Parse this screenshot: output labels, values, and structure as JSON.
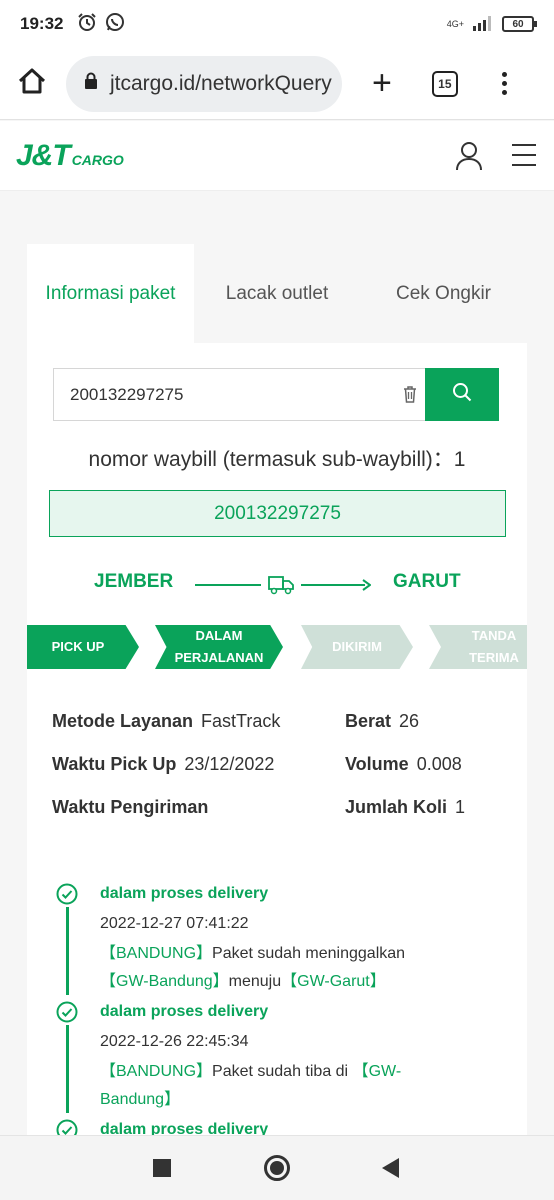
{
  "status_bar": {
    "time": "19:32",
    "network": "4G+",
    "battery": "60"
  },
  "browser": {
    "url": "jtcargo.id/networkQuery",
    "tab_count": "15"
  },
  "site": {
    "logo_main": "J&T",
    "logo_sub": "CARGO",
    "brand_color": "#0aa35a"
  },
  "tabs": [
    {
      "label": "Informasi paket",
      "active": true
    },
    {
      "label": "Lacak outlet",
      "active": false
    },
    {
      "label": "Cek Ongkir",
      "active": false
    }
  ],
  "search": {
    "value": "200132297275"
  },
  "waybill": {
    "count_label": "nomor waybill (termasuk sub-waybill)：1",
    "number": "200132297275"
  },
  "route": {
    "from": "JEMBER",
    "to": "GARUT"
  },
  "steps": [
    {
      "label": "PICK UP",
      "done": true
    },
    {
      "label": "DALAM PERJALANAN",
      "done": true
    },
    {
      "label": "DIKIRIM",
      "done": false
    },
    {
      "label": "TANDA TERIMA",
      "done": false
    }
  ],
  "info": {
    "method_label": "Metode Layanan",
    "method_value": "FastTrack",
    "pickup_label": "Waktu Pick Up",
    "pickup_value": "23/12/2022",
    "delivery_label": "Waktu Pengiriman",
    "delivery_value": "",
    "weight_label": "Berat",
    "weight_value": "26",
    "volume_label": "Volume",
    "volume_value": "0.008",
    "koli_label": "Jumlah Koli",
    "koli_value": "1"
  },
  "timeline": [
    {
      "title": "dalam proses delivery",
      "time": "2022-12-27 07:41:22",
      "city": "【BANDUNG】",
      "text1": "Paket sudah meninggalkan",
      "place1": "【GW-Bandung】",
      "text2": "menuju",
      "place2": "【GW-Garut】"
    },
    {
      "title": "dalam proses delivery",
      "time": "2022-12-26 22:45:34",
      "city": "【BANDUNG】",
      "text1": "Paket sudah tiba di",
      "place1": "【GW-Bandung】"
    },
    {
      "title": "dalam proses delivery"
    }
  ]
}
